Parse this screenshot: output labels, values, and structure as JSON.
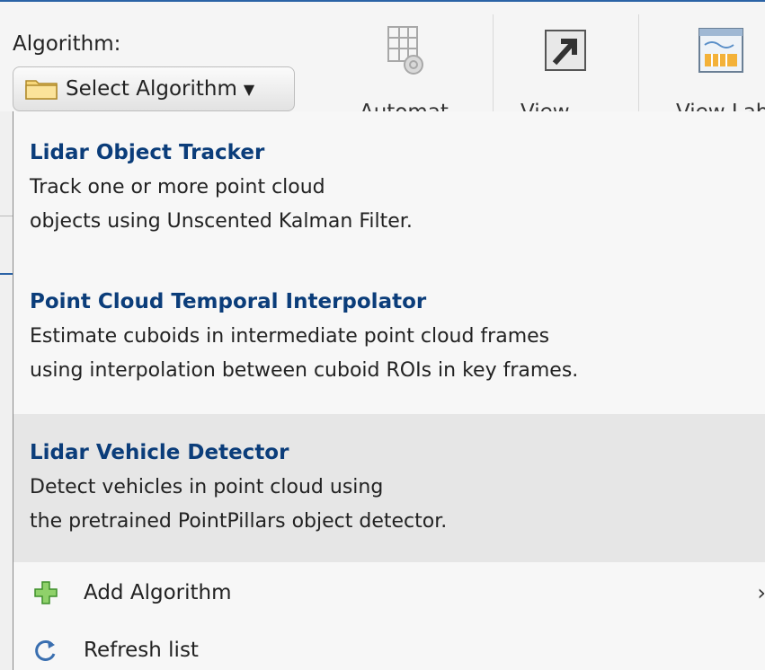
{
  "algorithm_label": "Algorithm:",
  "select_button": {
    "label": "Select Algorithm",
    "icon": "folder-icon"
  },
  "toolbar": {
    "automate": {
      "label": "Automate",
      "icon": "automate-gear-icon"
    },
    "view": {
      "label": "View",
      "icon": "arrow-out-icon"
    },
    "view_labels": {
      "label": "View Lab",
      "icon": "view-labels-icon"
    }
  },
  "dropdown": {
    "items": [
      {
        "title": "Lidar Object Tracker",
        "lines": [
          "Track one or more point cloud",
          "objects using Unscented Kalman Filter."
        ]
      },
      {
        "title": "Point Cloud Temporal Interpolator",
        "lines": [
          "Estimate cuboids in intermediate point cloud frames",
          "using interpolation between cuboid ROIs in key frames."
        ]
      },
      {
        "title": "Lidar Vehicle Detector",
        "lines": [
          "Detect vehicles in point cloud using",
          "the pretrained PointPillars object detector."
        ],
        "selected": true
      }
    ],
    "actions": [
      {
        "label": "Add Algorithm",
        "icon": "plus-icon",
        "has_submenu": true
      },
      {
        "label": "Refresh list",
        "icon": "refresh-icon"
      }
    ]
  },
  "colors": {
    "accent_title": "#0b3d7a",
    "top_bar": "#2b63a6",
    "selected_bg": "#e6e6e6"
  }
}
